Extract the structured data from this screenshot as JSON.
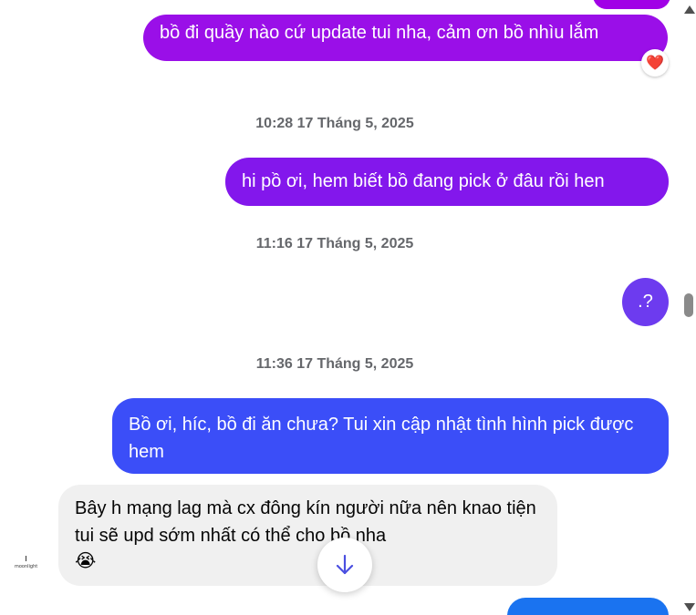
{
  "messages": [
    {
      "id": "m1",
      "text": "bồ đi quầy nào cứ update tui nha, cảm ơn bồ nhìu lắm",
      "reaction": "❤️"
    },
    {
      "id": "m2",
      "text": "hi pồ ơi, hem biết bồ đang pick ở đâu rồi hen"
    },
    {
      "id": "m3",
      "text": ".?"
    },
    {
      "id": "m4",
      "text": "Bồ ơi, híc, bồ đi ăn chưa? Tui xin cập nhật tình hình pick được hem"
    },
    {
      "id": "m5",
      "text": "Bây h mạng lag mà cx đông kín người nữa nên knao tiện tui sẽ upd sớm nhất có thể cho bồ nha",
      "emoji": "😭"
    },
    {
      "id": "m6",
      "text": ""
    }
  ],
  "timestamps": [
    "10:28 17 Tháng 5, 2025",
    "11:16 17 Tháng 5, 2025",
    "11:36 17 Tháng 5, 2025"
  ],
  "avatar": {
    "label": "moonlight"
  },
  "colors": {
    "purple": "#8b12e6",
    "violet": "#7a2cf0",
    "indigo": "#6b45ee",
    "blue": "#3a51f7",
    "incoming_bg": "#f0f0f0"
  }
}
